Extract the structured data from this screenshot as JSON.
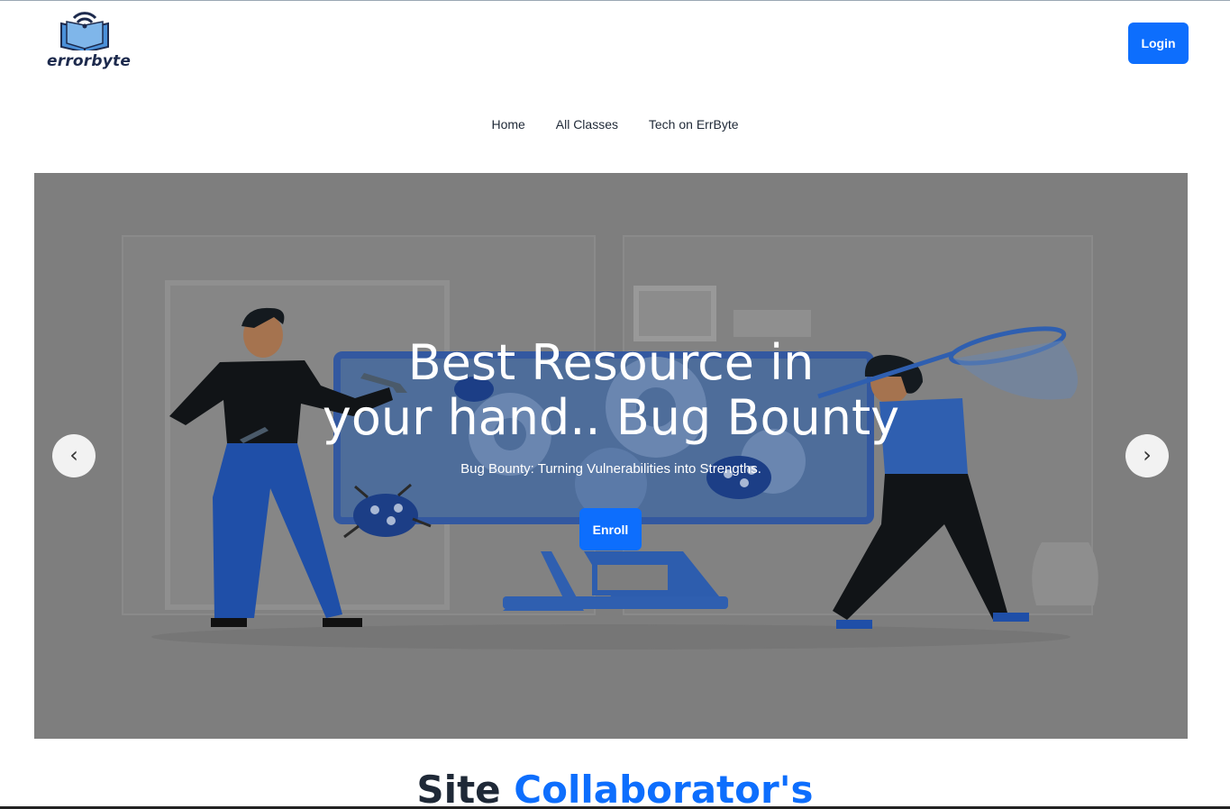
{
  "brand": {
    "logo_text": "errorbyte"
  },
  "header": {
    "login_label": "Login"
  },
  "nav": {
    "items": [
      "Home",
      "All Classes",
      "Tech on ErrByte"
    ]
  },
  "hero": {
    "title_line1": "Best Resource in",
    "title_line2": "your hand.. Bug Bounty",
    "subtitle": "Bug Bounty: Turning Vulnerabilities into Strengths.",
    "enroll_label": "Enroll",
    "prev_label": "‹",
    "next_label": "›"
  },
  "section": {
    "title_part1": "Site",
    "title_part2": "Collaborator's"
  },
  "colors": {
    "accent": "#0d6efd",
    "overlay": "#7e7e7e",
    "dark_text": "#1f2937"
  }
}
